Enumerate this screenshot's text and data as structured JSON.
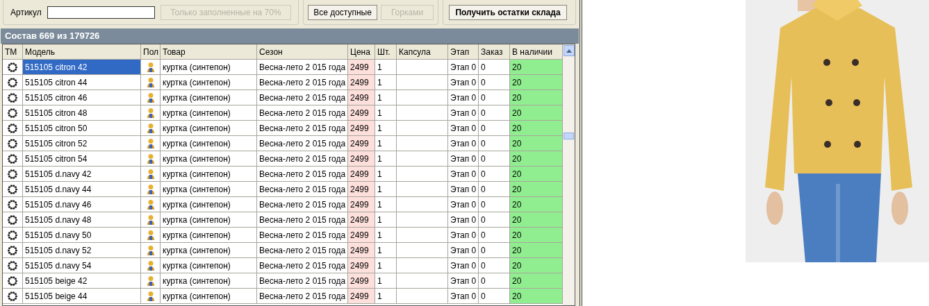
{
  "toolbar": {
    "article_label": "Артикул",
    "filter_button": {
      "label": "Только заполненные на 70%",
      "disabled": true
    },
    "view_buttons": [
      {
        "label": "Все доступные",
        "disabled": false
      },
      {
        "label": "Горками",
        "disabled": true
      }
    ],
    "action_button": {
      "label": "Получить остатки склада",
      "disabled": false
    }
  },
  "panel_title": "Состав 669 из 179726",
  "table": {
    "columns": [
      "ТМ",
      "Модель",
      "Пол",
      "Товар",
      "Сезон",
      "Цена",
      "Шт.",
      "Капсула",
      "Этап",
      "Заказ",
      "В наличии"
    ],
    "rows": [
      {
        "model": "515105 citron  42",
        "product": "куртка (синтепон)",
        "season": "Весна-лето 2 015 года",
        "price": "2499",
        "qty": "1",
        "stage": "Этап 0",
        "order": "0",
        "stock": "20",
        "selected": true
      },
      {
        "model": "515105 citron  44",
        "product": "куртка (синтепон)",
        "season": "Весна-лето 2 015 года",
        "price": "2499",
        "qty": "1",
        "stage": "Этап 0",
        "order": "0",
        "stock": "20",
        "selected": false
      },
      {
        "model": "515105 citron  46",
        "product": "куртка (синтепон)",
        "season": "Весна-лето 2 015 года",
        "price": "2499",
        "qty": "1",
        "stage": "Этап 0",
        "order": "0",
        "stock": "20",
        "selected": false
      },
      {
        "model": "515105 citron  48",
        "product": "куртка (синтепон)",
        "season": "Весна-лето 2 015 года",
        "price": "2499",
        "qty": "1",
        "stage": "Этап 0",
        "order": "0",
        "stock": "20",
        "selected": false
      },
      {
        "model": "515105 citron  50",
        "product": "куртка (синтепон)",
        "season": "Весна-лето 2 015 года",
        "price": "2499",
        "qty": "1",
        "stage": "Этап 0",
        "order": "0",
        "stock": "20",
        "selected": false
      },
      {
        "model": "515105 citron  52",
        "product": "куртка (синтепон)",
        "season": "Весна-лето 2 015 года",
        "price": "2499",
        "qty": "1",
        "stage": "Этап 0",
        "order": "0",
        "stock": "20",
        "selected": false
      },
      {
        "model": "515105 citron  54",
        "product": "куртка (синтепон)",
        "season": "Весна-лето 2 015 года",
        "price": "2499",
        "qty": "1",
        "stage": "Этап 0",
        "order": "0",
        "stock": "20",
        "selected": false
      },
      {
        "model": "515105 d.navy  42",
        "product": "куртка (синтепон)",
        "season": "Весна-лето 2 015 года",
        "price": "2499",
        "qty": "1",
        "stage": "Этап 0",
        "order": "0",
        "stock": "20",
        "selected": false
      },
      {
        "model": "515105 d.navy  44",
        "product": "куртка (синтепон)",
        "season": "Весна-лето 2 015 года",
        "price": "2499",
        "qty": "1",
        "stage": "Этап 0",
        "order": "0",
        "stock": "20",
        "selected": false
      },
      {
        "model": "515105 d.navy  46",
        "product": "куртка (синтепон)",
        "season": "Весна-лето 2 015 года",
        "price": "2499",
        "qty": "1",
        "stage": "Этап 0",
        "order": "0",
        "stock": "20",
        "selected": false
      },
      {
        "model": "515105 d.navy  48",
        "product": "куртка (синтепон)",
        "season": "Весна-лето 2 015 года",
        "price": "2499",
        "qty": "1",
        "stage": "Этап 0",
        "order": "0",
        "stock": "20",
        "selected": false
      },
      {
        "model": "515105 d.navy  50",
        "product": "куртка (синтепон)",
        "season": "Весна-лето 2 015 года",
        "price": "2499",
        "qty": "1",
        "stage": "Этап 0",
        "order": "0",
        "stock": "20",
        "selected": false
      },
      {
        "model": "515105 d.navy  52",
        "product": "куртка (синтепон)",
        "season": "Весна-лето 2 015 года",
        "price": "2499",
        "qty": "1",
        "stage": "Этап 0",
        "order": "0",
        "stock": "20",
        "selected": false
      },
      {
        "model": "515105 d.navy  54",
        "product": "куртка (синтепон)",
        "season": "Весна-лето 2 015 года",
        "price": "2499",
        "qty": "1",
        "stage": "Этап 0",
        "order": "0",
        "stock": "20",
        "selected": false
      },
      {
        "model": "515105 beige  42",
        "product": "куртка (синтепон)",
        "season": "Весна-лето 2 015 года",
        "price": "2499",
        "qty": "1",
        "stage": "Этап 0",
        "order": "0",
        "stock": "20",
        "selected": false
      },
      {
        "model": "515105 beige  44",
        "product": "куртка (синтепон)",
        "season": "Весна-лето 2 015 года",
        "price": "2499",
        "qty": "1",
        "stage": "Этап 0",
        "order": "0",
        "stock": "20",
        "selected": false
      }
    ]
  }
}
